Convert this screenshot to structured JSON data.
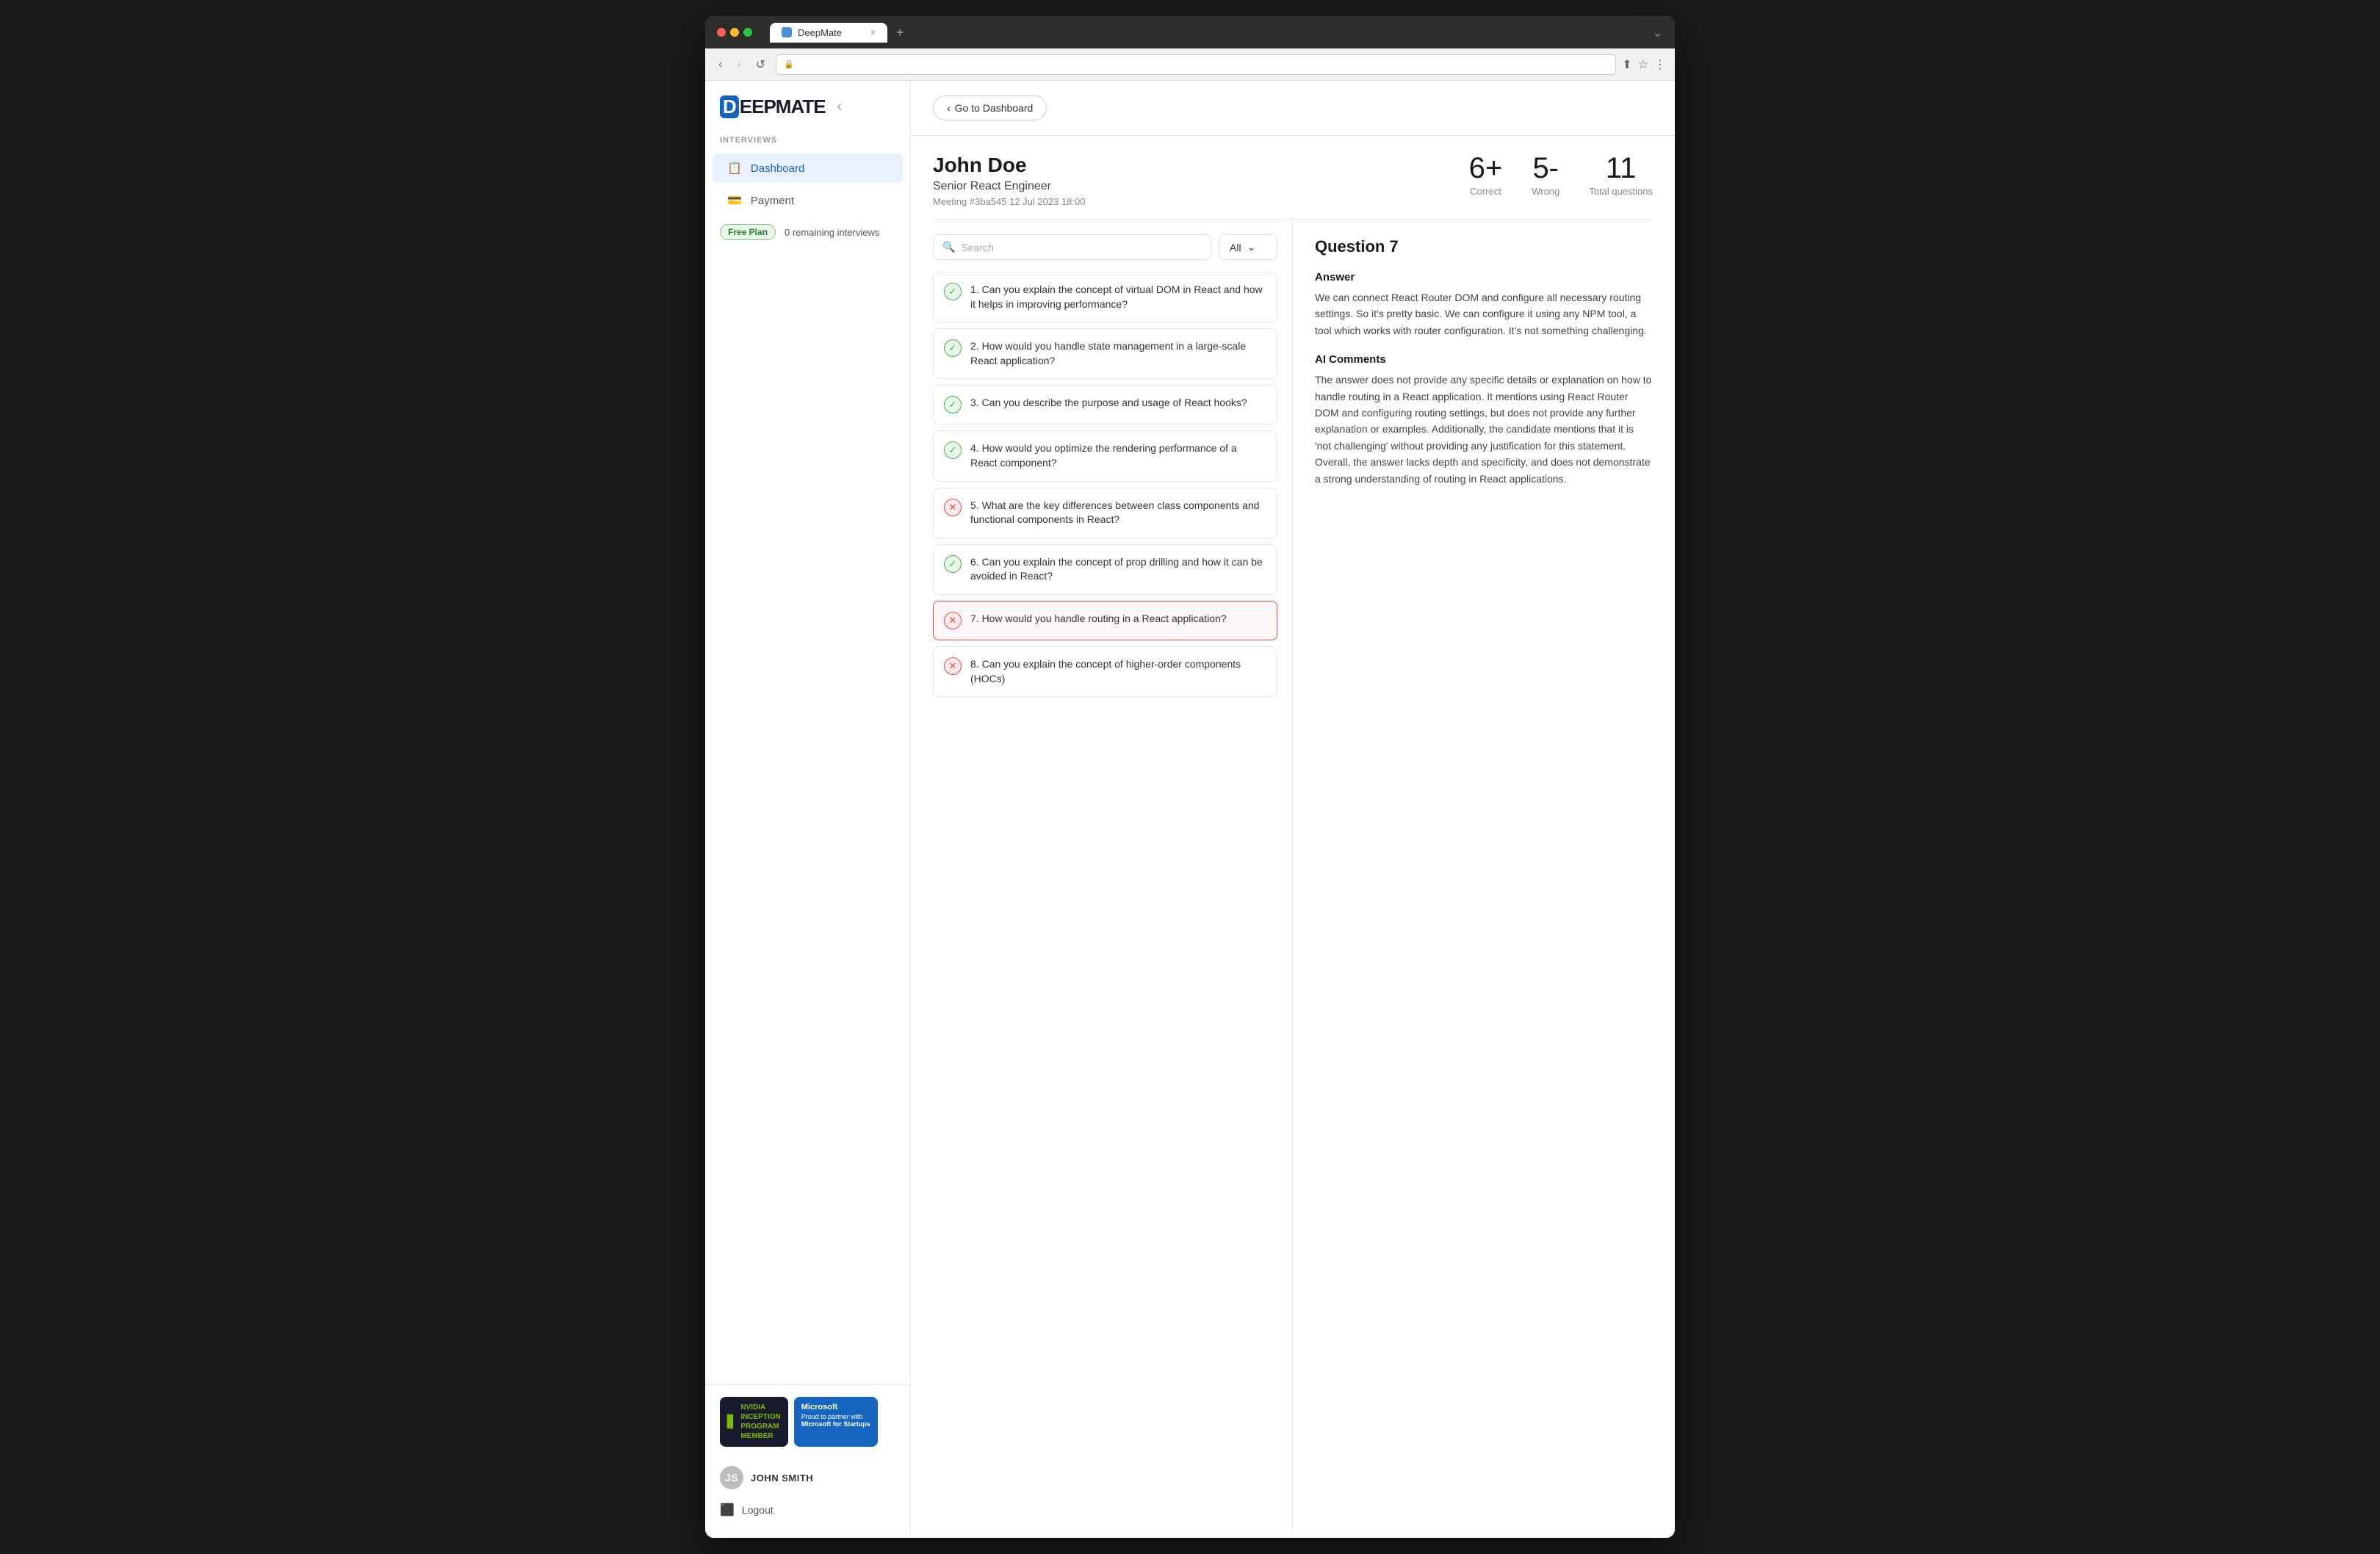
{
  "browser": {
    "tab_title": "DeepMate",
    "tab_icon": "D",
    "tab_close": "×",
    "tab_new": "+",
    "nav_back": "‹",
    "nav_forward": "›",
    "nav_refresh": "↺",
    "lock_icon": "🔒",
    "bookmark_icon": "☆",
    "share_icon": "⬆",
    "menu_icon": "⋮",
    "chevron_down": "⌄"
  },
  "sidebar": {
    "logo": "DEEPMATE",
    "logo_bracket": "‹",
    "section_label": "INTERVIEWS",
    "nav_items": [
      {
        "id": "dashboard",
        "label": "Dashboard",
        "icon": "📋",
        "active": true
      },
      {
        "id": "payment",
        "label": "Payment",
        "icon": "💳",
        "active": false
      }
    ],
    "plan": {
      "badge": "Free Plan",
      "remaining": "0 remaining interviews"
    },
    "nvidia_badge": {
      "line1": "NVIDIA",
      "line2": "INCEPTION",
      "line3": "PROGRAM",
      "line4": "MEMBER"
    },
    "microsoft_badge": {
      "line1": "Microsoft",
      "line2": "Proud to partner with",
      "line3": "Microsoft for Startups"
    },
    "user": "JOHN SMITH",
    "logout": "Logout"
  },
  "header": {
    "go_dashboard_label": "Go to Dashboard",
    "go_dashboard_icon": "‹"
  },
  "candidate": {
    "name": "John Doe",
    "role": "Senior React Engineer",
    "meeting_info": "Meeting #3ba545  12 Jul 2023 18:00"
  },
  "stats": {
    "correct": {
      "value": "6+",
      "label": "Correct"
    },
    "wrong": {
      "value": "5-",
      "label": "Wrong"
    },
    "total": {
      "value": "11",
      "label": "Total questions"
    }
  },
  "questions_panel": {
    "search_placeholder": "Search",
    "filter_default": "All",
    "filter_chevron": "⌄",
    "questions": [
      {
        "id": 1,
        "number": "1.",
        "text": "Can you explain the concept of virtual DOM in React and how it helps in improving performance?",
        "correct": true,
        "selected": false
      },
      {
        "id": 2,
        "number": "2.",
        "text": "How would you handle state management in a large-scale React application?",
        "correct": true,
        "selected": false
      },
      {
        "id": 3,
        "number": "3.",
        "text": "Can you describe the purpose and usage of React hooks?",
        "correct": true,
        "selected": false
      },
      {
        "id": 4,
        "number": "4.",
        "text": "How would you optimize the rendering performance of a React component?",
        "correct": true,
        "selected": false
      },
      {
        "id": 5,
        "number": "5.",
        "text": "What are the key differences between class components and functional components in React?",
        "correct": false,
        "selected": false
      },
      {
        "id": 6,
        "number": "6.",
        "text": "Can you explain the concept of prop drilling and how it can be avoided in React?",
        "correct": true,
        "selected": false
      },
      {
        "id": 7,
        "number": "7.",
        "text": "How would you handle routing in a React application?",
        "correct": false,
        "selected": true
      },
      {
        "id": 8,
        "number": "8.",
        "text": "Can you explain the concept of higher-order components (HOCs)",
        "correct": false,
        "selected": false
      }
    ]
  },
  "detail": {
    "title": "Question 7",
    "answer_label": "Answer",
    "answer_text": "We can connect React Router DOM and configure all necessary routing settings. So it's pretty basic. We can configure it using any NPM tool, a tool which works with router configuration. It's not something challenging.",
    "ai_comments_label": "AI Comments",
    "ai_comments_text": "The answer does not provide any specific details or explanation on how to handle routing in a React application. It mentions using React Router DOM and configuring routing settings, but does not provide any further explanation or examples. Additionally, the candidate mentions that it is 'not challenging' without providing any justification for this statement. Overall, the answer lacks depth and specificity, and does not demonstrate a strong understanding of routing in React applications."
  }
}
